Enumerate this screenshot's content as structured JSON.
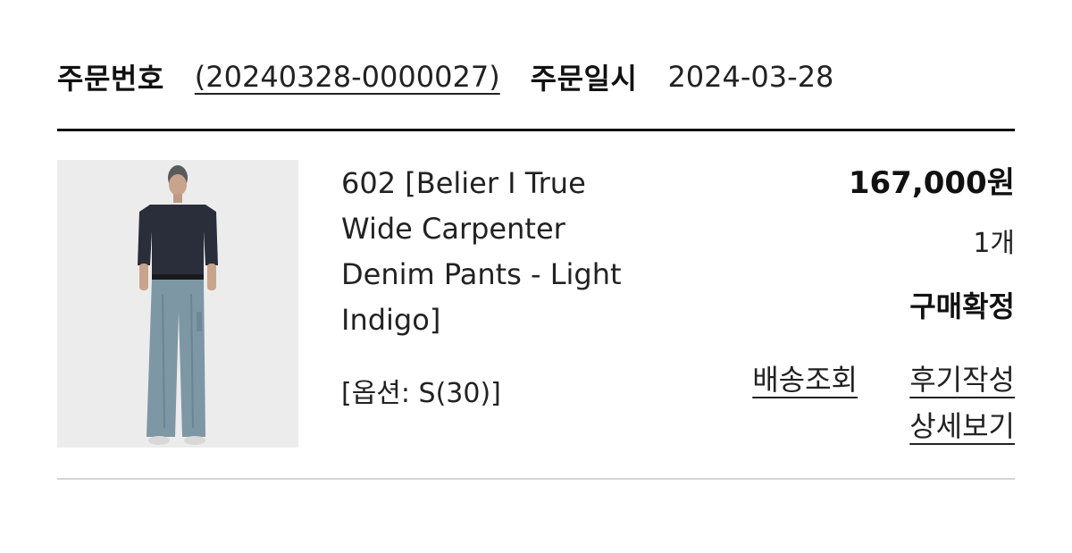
{
  "order": {
    "number_label": "주문번호",
    "number": "(20240328-0000027)",
    "date_label": "주문일시",
    "date": "2024-03-28"
  },
  "item": {
    "name_lines": [
      "602 [Belier I True",
      "Wide Carpenter",
      "Denim Pants - Light",
      "Indigo]"
    ],
    "option": "[옵션: S(30)]",
    "price": "167,000원",
    "quantity": "1개",
    "status": "구매확정"
  },
  "actions": {
    "track": "배송조회",
    "review": "후기작성",
    "detail": "상세보기"
  },
  "colors": {
    "thumbnail_bg": "#ebebeb",
    "divider_dark": "#111111",
    "divider_light": "#d4d4d4"
  }
}
